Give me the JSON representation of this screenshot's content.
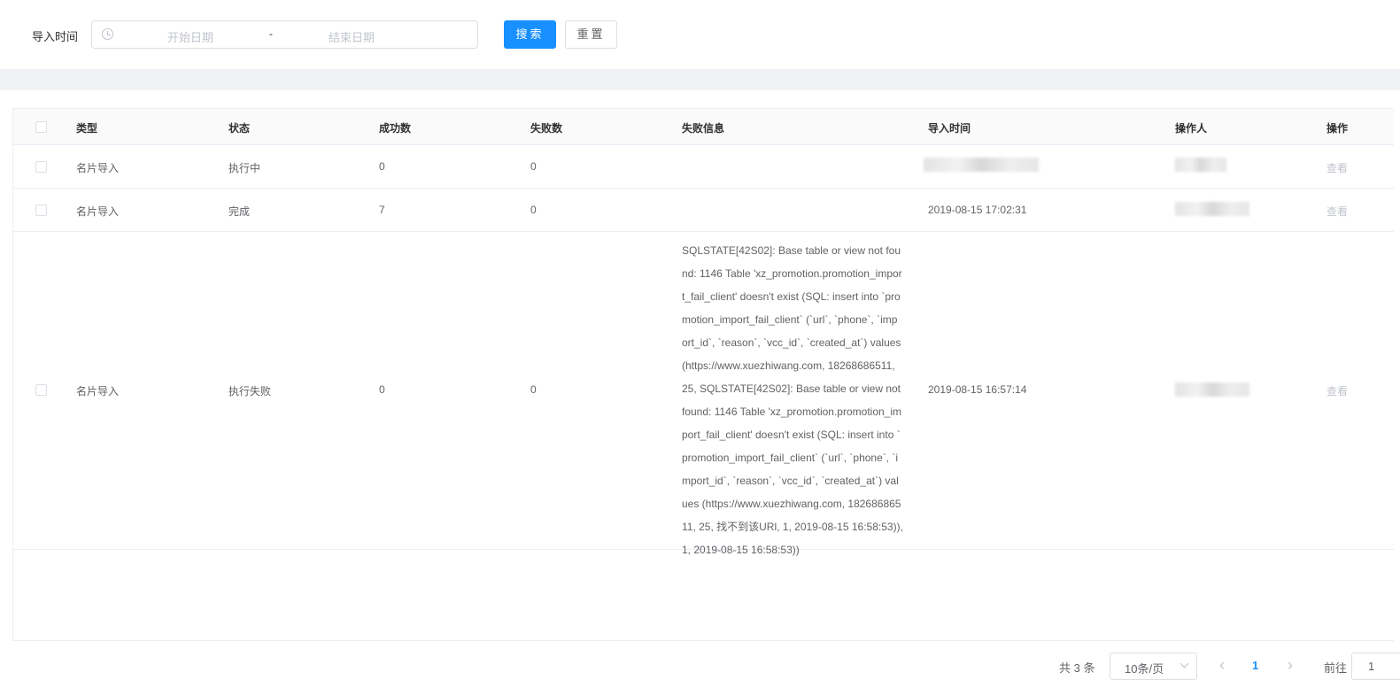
{
  "filter": {
    "label": "导入时间",
    "start_placeholder": "开始日期",
    "separator": "-",
    "end_placeholder": "结束日期",
    "search": "搜索",
    "reset": "重置"
  },
  "table": {
    "headers": [
      "类型",
      "状态",
      "成功数",
      "失败数",
      "失败信息",
      "导入时间",
      "操作人",
      "操作"
    ],
    "rows": [
      {
        "type": "名片导入",
        "status": "执行中",
        "success": "0",
        "fail": "0",
        "message": "",
        "time": "",
        "action": "查看"
      },
      {
        "type": "名片导入",
        "status": "完成",
        "success": "7",
        "fail": "0",
        "message": "",
        "time": "2019-08-15 17:02:31",
        "action": "查看"
      },
      {
        "type": "名片导入",
        "status": "执行失败",
        "success": "0",
        "fail": "0",
        "message": "SQLSTATE[42S02]: Base table or view not found: 1146 Table 'xz_promotion.promotion_import_fail_client' doesn't exist (SQL: insert into `promotion_import_fail_client` (`url`, `phone`, `import_id`, `reason`, `vcc_id`, `created_at`) values (https://www.xuezhiwang.com, 18268686511, 25, SQLSTATE[42S02]: Base table or view not found: 1146 Table 'xz_promotion.promotion_import_fail_client' doesn't exist (SQL: insert into `promotion_import_fail_client` (`url`, `phone`, `import_id`, `reason`, `vcc_id`, `created_at`) values (https://www.xuezhiwang.com, 18268686511, 25, 找不到该URl, 1, 2019-08-15 16:58:53)), 1, 2019-08-15 16:58:53))",
        "time": "2019-08-15 16:57:14",
        "action": "查看"
      }
    ]
  },
  "pagination": {
    "total": "共 3 条",
    "page_size": "10条/页",
    "prev": "‹",
    "current": "1",
    "next": "›",
    "goto_label": "前往",
    "goto_value": "1"
  }
}
